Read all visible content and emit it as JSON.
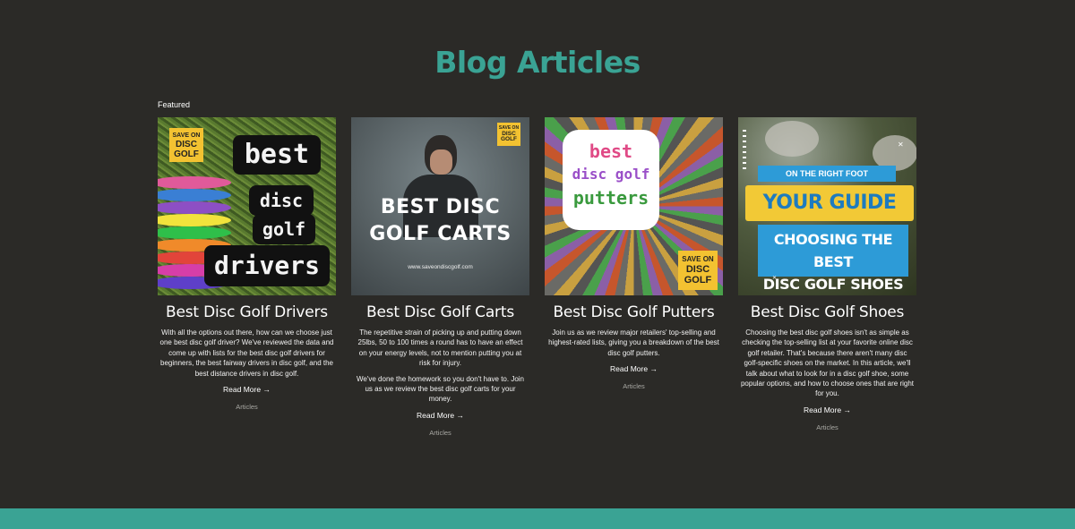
{
  "section": {
    "heading": "Blog Articles",
    "featured_label": "Featured"
  },
  "colors": {
    "accent": "#3aa394",
    "background": "#2b2a27",
    "logo_yellow": "#f3c231"
  },
  "posts": [
    {
      "title": "Best Disc Golf Drivers",
      "excerpt": [
        "With all the options out there, how can we choose just one best disc golf driver? We've reviewed the data and come up with lists for the best disc golf drivers for beginners, the best fairway drivers in disc golf, and the best distance drivers in disc golf."
      ],
      "read_more": "Read More →",
      "category": "Articles",
      "thumb": {
        "logo": [
          "SAVE ON",
          "DISC",
          "GOLF"
        ],
        "words": [
          "best",
          "disc",
          "golf",
          "drivers"
        ]
      }
    },
    {
      "title": "Best Disc Golf Carts",
      "excerpt": [
        "The repetitive strain of picking up and putting down 25lbs, 50 to 100 times a round has to have an effect on your energy levels, not to mention putting you at risk for injury.",
        "We've done the homework so you don't have to. Join us as we review the best disc golf carts for your money."
      ],
      "read_more": "Read More →",
      "category": "Articles",
      "thumb": {
        "logo": [
          "SAVE ON",
          "DISC",
          "GOLF"
        ],
        "title_lines": [
          "BEST DISC",
          "GOLF CARTS"
        ],
        "url": "www.saveondiscgolf.com"
      }
    },
    {
      "title": "Best Disc Golf Putters",
      "excerpt": [
        "Join us as we review major retailers' top-selling and highest-rated lists, giving you a breakdown of the best disc golf putters."
      ],
      "read_more": "Read More →",
      "category": "Articles",
      "thumb": {
        "logo": [
          "SAVE ON",
          "DISC",
          "GOLF"
        ],
        "words": [
          "best",
          "disc golf",
          "putters"
        ]
      }
    },
    {
      "title": "Best Disc Golf Shoes",
      "excerpt": [
        "Choosing the best disc golf shoes isn't as simple as checking the top-selling list at your favorite online disc golf retailer. That's because there aren't many disc golf-specific shoes on the market. In this article, we'll talk about what to look for in a disc golf shoe, some popular options, and how to choose ones that are right for you."
      ],
      "read_more": "Read More →",
      "category": "Articles",
      "thumb": {
        "kicker": "ON THE RIGHT FOOT",
        "line1": "YOUR GUIDE TO",
        "line2": [
          "CHOOSING THE BEST",
          "DISC GOLF SHOES"
        ],
        "close": "✕"
      }
    }
  ]
}
